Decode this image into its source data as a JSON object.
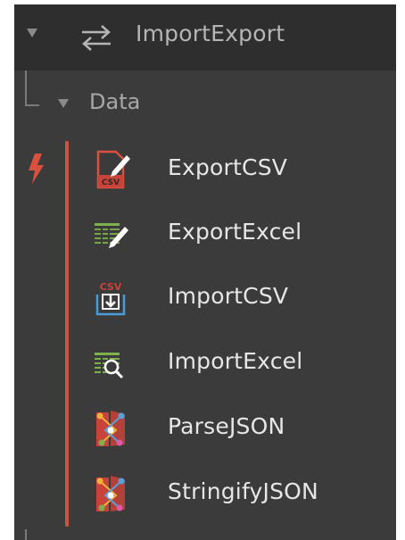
{
  "header": {
    "title": "ImportExport"
  },
  "category": {
    "label": "Data"
  },
  "colors": {
    "panel_bg": "#3b3b3b",
    "header_bg": "#2e2e2e",
    "accent": "#c8533f",
    "label_text": "#e6e6e6"
  },
  "nodes": [
    {
      "label": "ExportCSV",
      "icon": "export-csv-icon"
    },
    {
      "label": "ExportExcel",
      "icon": "export-excel-icon"
    },
    {
      "label": "ImportCSV",
      "icon": "import-csv-icon"
    },
    {
      "label": "ImportExcel",
      "icon": "import-excel-icon"
    },
    {
      "label": "ParseJSON",
      "icon": "parse-json-icon"
    },
    {
      "label": "StringifyJSON",
      "icon": "stringify-json-icon"
    }
  ]
}
